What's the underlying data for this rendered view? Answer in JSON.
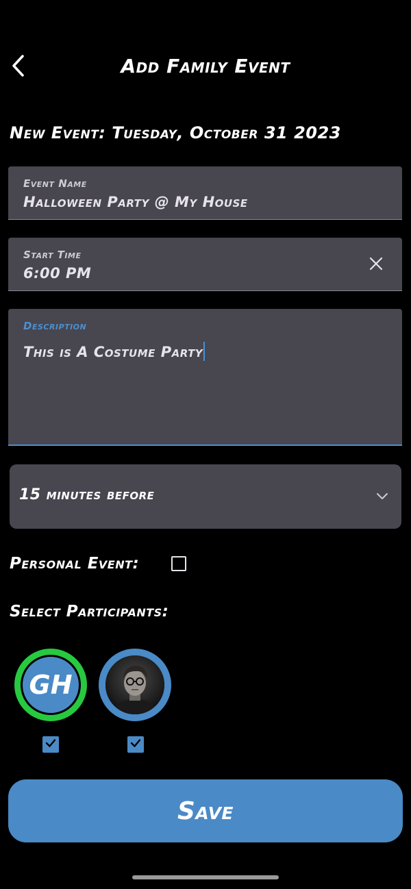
{
  "header": {
    "title": "Add Family Event",
    "back_icon": "chevron-left-icon"
  },
  "event_date_heading": "New Event: Tuesday, October 31 2023",
  "fields": {
    "event_name": {
      "label": "Event Name",
      "value": "Halloween Party @ My House"
    },
    "start_time": {
      "label": "Start Time",
      "value": "6:00 PM",
      "clear_icon": "close-icon"
    },
    "description": {
      "label": "Description",
      "value": "This is A Costume Party"
    }
  },
  "reminder": {
    "selected": "15 minutes before",
    "icon": "chevron-down-icon"
  },
  "personal_event": {
    "label": "Personal Event:",
    "checked": false
  },
  "participants": {
    "label": "Select Participants:",
    "items": [
      {
        "initials": "GH",
        "selected": true,
        "ring_color": "#27c93f"
      },
      {
        "initials": "",
        "selected": true,
        "ring_color": "#4a8ac6",
        "avatar": "profile-photo"
      }
    ]
  },
  "save_label": "Save",
  "colors": {
    "background": "#000000",
    "field_bg": "#48464f",
    "accent": "#4a8ac6",
    "focus": "#4a90d0",
    "green_ring": "#27c93f"
  }
}
